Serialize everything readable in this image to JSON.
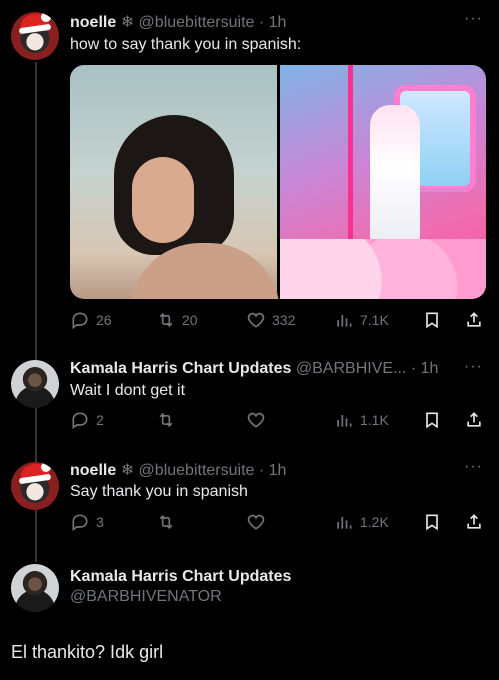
{
  "tweets": [
    {
      "name": "noelle",
      "badge": "❄",
      "handle": "@bluebittersuite",
      "time": "· 1h",
      "text": "how to say thank you in spanish:",
      "replies": "26",
      "retweets": "20",
      "likes": "332",
      "views": "7.1K"
    },
    {
      "name": "Kamala Harris Chart Updates",
      "handle": "@BARBHIVE...",
      "time": "· 1h",
      "text": "Wait I dont get it",
      "replies": "2",
      "retweets": "",
      "likes": "",
      "views": "1.1K"
    },
    {
      "name": "noelle",
      "badge": "❄",
      "handle": "@bluebittersuite",
      "time": "· 1h",
      "text": "Say thank you in spanish",
      "replies": "3",
      "retweets": "",
      "likes": "",
      "views": "1.2K"
    }
  ],
  "main": {
    "name": "Kamala Harris Chart Updates",
    "handle": "@BARBHIVENATOR",
    "text": "El thankito? Idk girl"
  },
  "more_glyph": "···",
  "colors": {
    "background": "#000000",
    "text": "#e7e9ea",
    "muted": "#71767b",
    "thread": "#333639"
  }
}
